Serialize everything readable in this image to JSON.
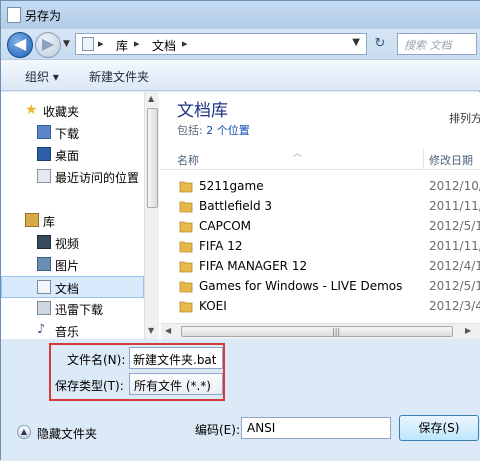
{
  "window": {
    "title": "另存为"
  },
  "address": {
    "crumbs": [
      "库",
      "文档"
    ],
    "separator": "▸"
  },
  "search": {
    "placeholder": "搜索 文档"
  },
  "toolbar": {
    "organize_label": "组织 ▾",
    "new_folder_label": "新建文件夹"
  },
  "nav": {
    "items": [
      {
        "label": "收藏夹",
        "icon": "star-icon"
      },
      {
        "label": "下载",
        "icon": "download-folder-icon"
      },
      {
        "label": "桌面",
        "icon": "desktop-icon"
      },
      {
        "label": "最近访问的位置",
        "icon": "recent-places-icon"
      },
      {
        "label": "库",
        "icon": "library-icon"
      },
      {
        "label": "视频",
        "icon": "video-library-icon"
      },
      {
        "label": "图片",
        "icon": "picture-library-icon"
      },
      {
        "label": "文档",
        "icon": "document-library-icon",
        "selected": true
      },
      {
        "label": "迅雷下载",
        "icon": "thunder-download-icon"
      },
      {
        "label": "音乐",
        "icon": "music-library-icon"
      }
    ]
  },
  "library": {
    "title": "文档库",
    "includes_label": "包括:",
    "includes_value": "2 个位置",
    "arrange_label": "排列方"
  },
  "columns": {
    "name": "名称",
    "date": "修改日期"
  },
  "files": [
    {
      "name": "5211game",
      "date": "2012/10/"
    },
    {
      "name": "Battlefield 3",
      "date": "2011/11/"
    },
    {
      "name": "CAPCOM",
      "date": "2012/5/1"
    },
    {
      "name": "FIFA 12",
      "date": "2011/11/"
    },
    {
      "name": "FIFA MANAGER 12",
      "date": "2012/4/1"
    },
    {
      "name": "Games for Windows - LIVE Demos",
      "date": "2012/5/1"
    },
    {
      "name": "KOEI",
      "date": "2012/3/4"
    }
  ],
  "form": {
    "filename_label": "文件名(N):",
    "filename_value": "新建文件夹.bat",
    "filetype_label": "保存类型(T):",
    "filetype_value": "所有文件  (*.*)",
    "hide_folders_label": "隐藏文件夹",
    "encoding_label": "编码(E):",
    "encoding_value": "ANSI",
    "save_label": "保存(S)"
  },
  "colors": {
    "highlight_box": "#d63a3a",
    "library_title": "#1e3287",
    "folder": "#e8b94a"
  }
}
